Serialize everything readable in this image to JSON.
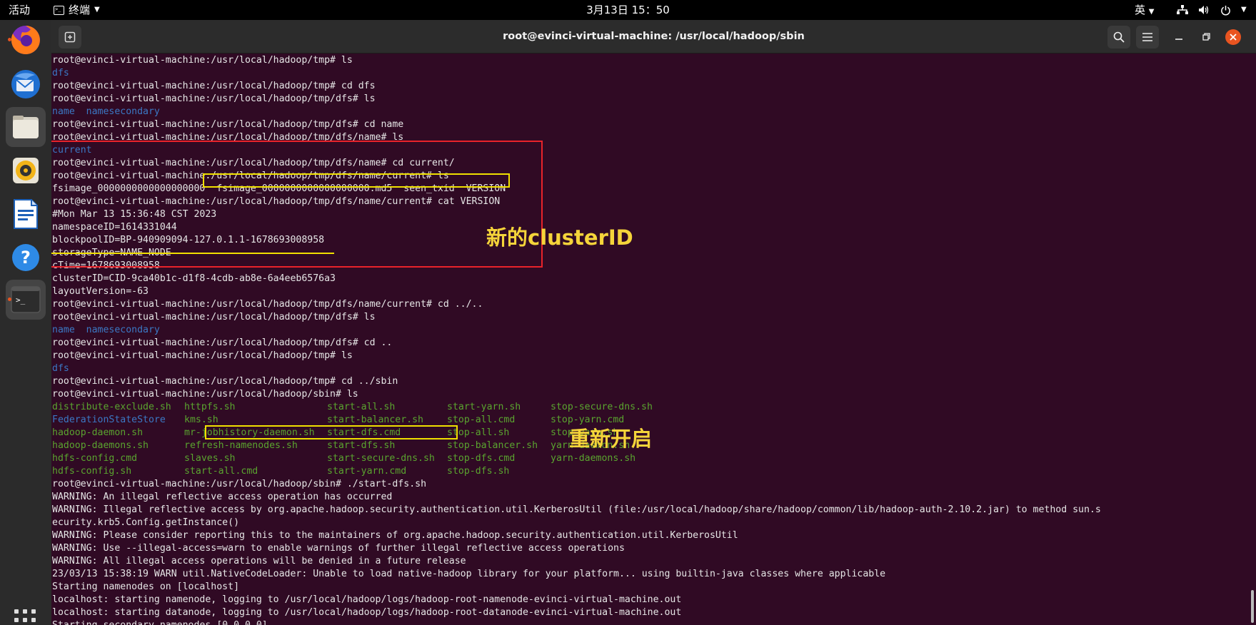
{
  "topbar": {
    "activities": "活动",
    "app_name": "终端",
    "clock": "3月13日  15：50",
    "ime": "英"
  },
  "dock": {
    "tooltip": "文件",
    "items": [
      "firefox-icon",
      "thunderbird-icon",
      "files-icon",
      "rhythmbox-icon",
      "libreoffice-writer-icon",
      "help-icon",
      "terminal-icon"
    ]
  },
  "window": {
    "title": "root@evinci-virtual-machine: /usr/local/hadoop/sbin"
  },
  "terminal": {
    "lines_top": [
      {
        "t": "root@evinci-virtual-machine:/usr/local/hadoop/tmp# ls",
        "c": ""
      },
      {
        "t": "dfs",
        "c": "blue"
      },
      {
        "t": "root@evinci-virtual-machine:/usr/local/hadoop/tmp# cd dfs",
        "c": ""
      },
      {
        "t": "root@evinci-virtual-machine:/usr/local/hadoop/tmp/dfs# ls",
        "c": ""
      },
      {
        "t": "name  namesecondary",
        "c": "blue"
      },
      {
        "t": "root@evinci-virtual-machine:/usr/local/hadoop/tmp/dfs# cd name",
        "c": ""
      },
      {
        "t": "root@evinci-virtual-machine:/usr/local/hadoop/tmp/dfs/name# ls",
        "c": ""
      },
      {
        "t": "current",
        "c": "blue"
      },
      {
        "t": "root@evinci-virtual-machine:/usr/local/hadoop/tmp/dfs/name# cd current/",
        "c": ""
      },
      {
        "t": "root@evinci-virtual-machine:/usr/local/hadoop/tmp/dfs/name/current# ls",
        "c": ""
      },
      {
        "t": "fsimage_0000000000000000000  fsimage_0000000000000000000.md5  seen_txid  VERSION",
        "c": ""
      },
      {
        "t": "root@evinci-virtual-machine:/usr/local/hadoop/tmp/dfs/name/current# cat VERSION",
        "c": ""
      },
      {
        "t": "#Mon Mar 13 15:36:48 CST 2023",
        "c": ""
      },
      {
        "t": "namespaceID=1614331044",
        "c": ""
      },
      {
        "t": "blockpoolID=BP-940909094-127.0.1.1-1678693008958",
        "c": ""
      },
      {
        "t": "storageType=NAME_NODE",
        "c": ""
      },
      {
        "t": "cTime=1678693008958",
        "c": ""
      },
      {
        "t": "clusterID=CID-9ca40b1c-d1f8-4cdb-ab8e-6a4eeb6576a3",
        "c": ""
      },
      {
        "t": "layoutVersion=-63",
        "c": ""
      },
      {
        "t": "root@evinci-virtual-machine:/usr/local/hadoop/tmp/dfs/name/current# cd ../..",
        "c": ""
      },
      {
        "t": "root@evinci-virtual-machine:/usr/local/hadoop/tmp/dfs# ls",
        "c": ""
      },
      {
        "t": "name  namesecondary",
        "c": "blue"
      },
      {
        "t": "root@evinci-virtual-machine:/usr/local/hadoop/tmp/dfs# cd ..",
        "c": ""
      },
      {
        "t": "root@evinci-virtual-machine:/usr/local/hadoop/tmp# ls",
        "c": ""
      },
      {
        "t": "dfs",
        "c": "blue"
      },
      {
        "t": "root@evinci-virtual-machine:/usr/local/hadoop/tmp# cd ../sbin",
        "c": ""
      },
      {
        "t": "root@evinci-virtual-machine:/usr/local/hadoop/sbin# ls",
        "c": ""
      }
    ],
    "ls_grid": [
      [
        "distribute-exclude.sh",
        "httpfs.sh",
        "start-all.sh",
        "start-yarn.sh",
        "stop-secure-dns.sh"
      ],
      [
        "FederationStateStore",
        "kms.sh",
        "start-balancer.sh",
        "stop-all.cmd",
        "stop-yarn.cmd"
      ],
      [
        "hadoop-daemon.sh",
        "mr-jobhistory-daemon.sh",
        "start-dfs.cmd",
        "stop-all.sh",
        "stop-yarn.sh"
      ],
      [
        "hadoop-daemons.sh",
        "refresh-namenodes.sh",
        "start-dfs.sh",
        "stop-balancer.sh",
        "yarn-daemon.sh"
      ],
      [
        "hdfs-config.cmd",
        "slaves.sh",
        "start-secure-dns.sh",
        "stop-dfs.cmd",
        "yarn-daemons.sh"
      ],
      [
        "hdfs-config.sh",
        "start-all.cmd",
        "start-yarn.cmd",
        "stop-dfs.sh",
        ""
      ]
    ],
    "lines_bottom": [
      {
        "t": "root@evinci-virtual-machine:/usr/local/hadoop/sbin# ./start-dfs.sh",
        "c": ""
      },
      {
        "t": "WARNING: An illegal reflective access operation has occurred",
        "c": ""
      },
      {
        "t": "WARNING: Illegal reflective access by org.apache.hadoop.security.authentication.util.KerberosUtil (file:/usr/local/hadoop/share/hadoop/common/lib/hadoop-auth-2.10.2.jar) to method sun.s",
        "c": ""
      },
      {
        "t": "ecurity.krb5.Config.getInstance()",
        "c": ""
      },
      {
        "t": "WARNING: Please consider reporting this to the maintainers of org.apache.hadoop.security.authentication.util.KerberosUtil",
        "c": ""
      },
      {
        "t": "WARNING: Use --illegal-access=warn to enable warnings of further illegal reflective access operations",
        "c": ""
      },
      {
        "t": "WARNING: All illegal access operations will be denied in a future release",
        "c": ""
      },
      {
        "t": "23/03/13 15:38:19 WARN util.NativeCodeLoader: Unable to load native-hadoop library for your platform... using builtin-java classes where applicable",
        "c": ""
      },
      {
        "t": "Starting namenodes on [localhost]",
        "c": ""
      },
      {
        "t": "localhost: starting namenode, logging to /usr/local/hadoop/logs/hadoop-root-namenode-evinci-virtual-machine.out",
        "c": ""
      },
      {
        "t": "localhost: starting datanode, logging to /usr/local/hadoop/logs/hadoop-root-datanode-evinci-virtual-machine.out",
        "c": ""
      },
      {
        "t": "Starting secondary namenodes [0.0.0.0]",
        "c": ""
      }
    ]
  },
  "annotations": {
    "new_cluster_id": "新的clusterID",
    "restart": "重新开启"
  },
  "colors": {
    "terminal_bg": "#300a24",
    "dir_blue": "#3b78c4",
    "exec_green": "#5aa42f",
    "red_box": "#e8232a",
    "yellow_mark": "#f0e000",
    "note_text": "#f5d43a"
  }
}
